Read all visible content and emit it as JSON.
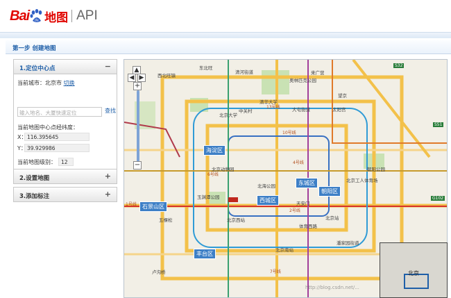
{
  "header": {
    "logo_text_1": "Bai",
    "logo_text_2": "地图",
    "logo_api": "API"
  },
  "step": {
    "title": "第一步 创建地图"
  },
  "panel": {
    "sections": [
      {
        "label": "1.定位中心点",
        "icon": "minus"
      },
      {
        "label": "2.设置地图",
        "icon": "plus"
      },
      {
        "label": "3.添加标注",
        "icon": "plus"
      }
    ],
    "current_city_label": "当前城市：北京市",
    "switch_link": "切换",
    "search_placeholder": "输入地名、大厦快速定位",
    "search_button": "查找",
    "center_label": "当前地图中心点经纬度：",
    "x_label": "X：",
    "x_value": "116.395645",
    "y_label": "Y：",
    "y_value": "39.929986",
    "zoom_label": "当前地图级别：",
    "zoom_value": "12"
  },
  "map": {
    "districts": [
      "海淀区",
      "东城区",
      "西城区",
      "朝阳区",
      "石景山区",
      "丰台区"
    ],
    "labels": [
      "西北旺镇",
      "东北旺",
      "清河街道",
      "奥林匹克公园",
      "来广营",
      "望京",
      "中关村",
      "北京大学",
      "清华大学",
      "大屯街道",
      "太阳宫",
      "北京动物园",
      "北京西站",
      "北京南站",
      "天安门",
      "北京工人体育场",
      "朝阳公园",
      "北海公园",
      "体育西路",
      "北京站",
      "潘家园街道",
      "玉渊潭公园",
      "五棵松",
      "卢沟桥",
      "丰台区",
      "南苑",
      "北京城区",
      "国贸",
      "香山",
      "石景山区"
    ],
    "roads": [
      "13号线",
      "10号线",
      "4号线",
      "1号线",
      "2号线",
      "5号线",
      "6号线",
      "7号线",
      "9号线",
      "14号线",
      "8号线",
      "15号线"
    ],
    "highways": [
      "S32",
      "G101",
      "S51",
      "G102",
      "G45"
    ],
    "overview_label": "北京"
  },
  "watermark": "http://blog.csdn.net/..."
}
